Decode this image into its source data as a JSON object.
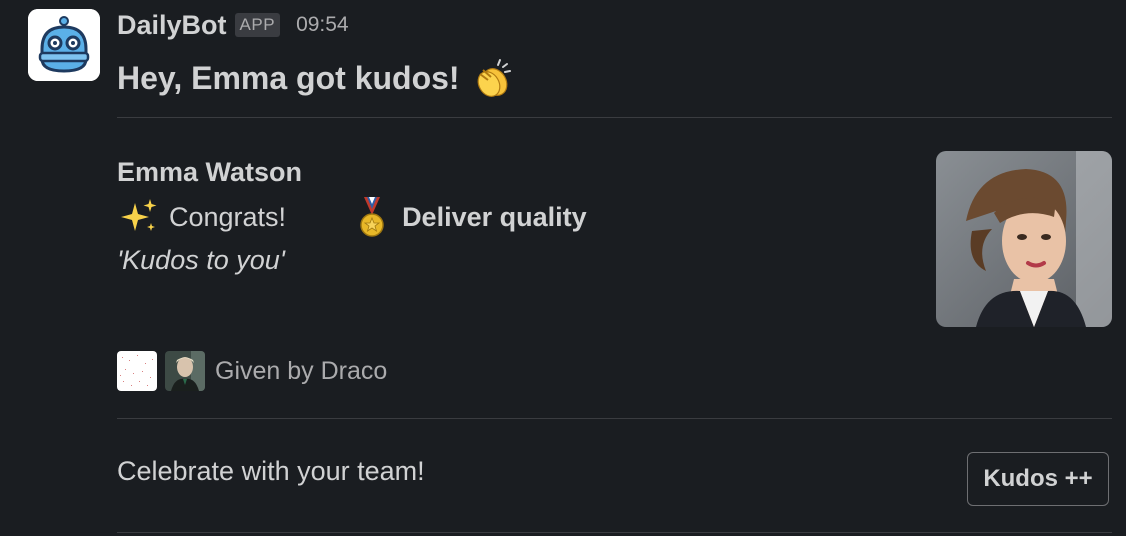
{
  "message": {
    "sender": "DailyBot",
    "badge": "APP",
    "time": "09:54",
    "headline": "Hey, Emma got kudos!",
    "headline_emoji": "clapping-hands-icon"
  },
  "kudos": {
    "recipient": "Emma Watson",
    "reason_icon": "sparkles-icon",
    "reason": "Congrats!",
    "value_icon": "medal-icon",
    "value": "Deliver quality",
    "quote": "'Kudos to you'",
    "given_by": "Given by Draco"
  },
  "footer": {
    "prompt": "Celebrate with your team!",
    "button_label": "Kudos ++"
  },
  "colors": {
    "background": "#1a1d21",
    "text": "#d1d2d3",
    "muted": "#ababad",
    "divider": "#3a3c40",
    "bot_blue": "#4aa3df"
  }
}
